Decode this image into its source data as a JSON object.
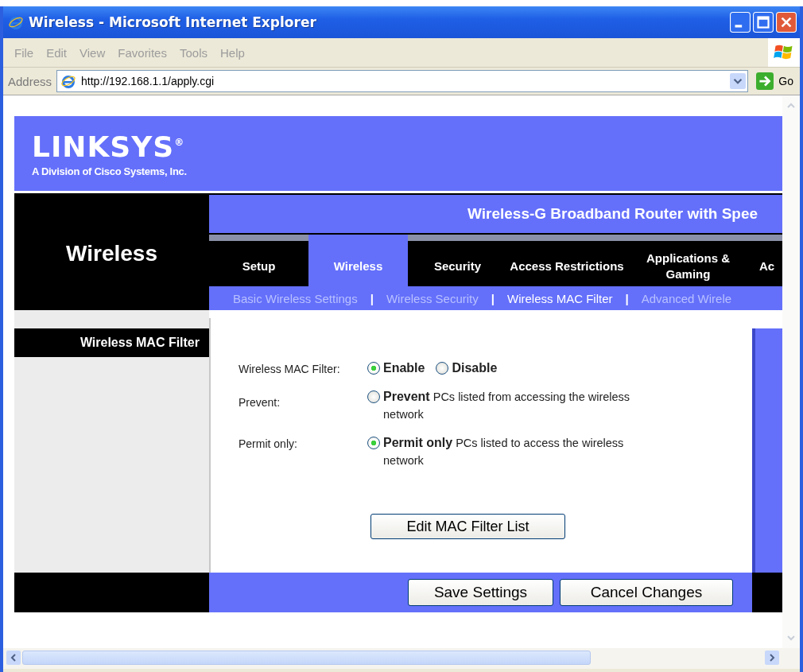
{
  "window": {
    "title": "Wireless - Microsoft Internet Explorer"
  },
  "menu": [
    "File",
    "Edit",
    "View",
    "Favorites",
    "Tools",
    "Help"
  ],
  "address_bar": {
    "label": "Address",
    "value": "http://192.168.1.1/apply.cgi",
    "go": "Go"
  },
  "page": {
    "logo": {
      "name": "LINKSYS",
      "mark": "®",
      "tagline": "A Division of Cisco Systems, Inc."
    },
    "section_title": "Wireless",
    "product": "Wireless-G Broadband Router with Spee",
    "tabs": [
      {
        "label": "Setup",
        "selected": false
      },
      {
        "label": "Wireless",
        "selected": true
      },
      {
        "label": "Security",
        "selected": false
      },
      {
        "label": "Access Restrictions",
        "selected": false
      },
      {
        "label": "Applications & Gaming",
        "selected": false
      },
      {
        "label": "Ac",
        "selected": false
      }
    ],
    "subtabs": [
      {
        "label": "Basic Wireless Settings",
        "selected": false,
        "separator": "|"
      },
      {
        "label": "Wireless Security",
        "selected": false,
        "separator": "|"
      },
      {
        "label": "Wireless MAC Filter",
        "selected": true,
        "separator": "|"
      },
      {
        "label": "Advanced Wirele",
        "selected": false
      }
    ],
    "sidebar_heading": "Wireless MAC Filter",
    "form": [
      {
        "label": "Wireless MAC Filter:",
        "kind": "toggle",
        "options": [
          {
            "text": "Enable",
            "selected": true
          },
          {
            "text": "Disable",
            "selected": false
          }
        ]
      },
      {
        "label": "Prevent:",
        "kind": "choice",
        "options": [
          {
            "text": "**Prevent** PCs listed from accessing the wireless network",
            "selected": false
          }
        ]
      },
      {
        "label": "Permit only:",
        "kind": "choice",
        "options": [
          {
            "text": "**Permit only** PCs listed to access the wireless network",
            "selected": true
          }
        ]
      }
    ],
    "edit_button": "Edit MAC Filter List",
    "buttons": [
      "Save Settings",
      "Cancel Changes"
    ]
  }
}
